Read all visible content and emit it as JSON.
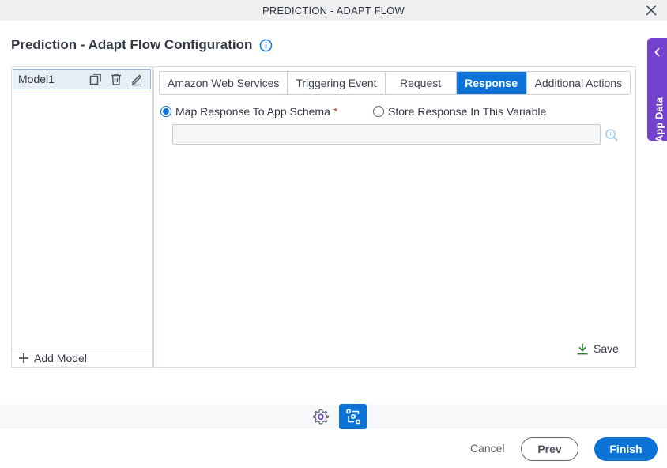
{
  "window": {
    "title": "PREDICTION - ADAPT FLOW",
    "close_icon": "close-icon"
  },
  "header": {
    "title": "Prediction - Adapt Flow Configuration",
    "info_icon": "info-icon"
  },
  "app_data_panel": {
    "label": "App Data",
    "icon": "chevron-left-icon"
  },
  "models": {
    "items": [
      {
        "name": "Model1",
        "actions": [
          "copy-icon",
          "delete-icon",
          "edit-icon"
        ]
      }
    ],
    "add_label": "Add Model"
  },
  "tabs": [
    {
      "label": "Amazon Web Services",
      "active": false
    },
    {
      "label": "Triggering Event",
      "active": false
    },
    {
      "label": "Request",
      "active": false
    },
    {
      "label": "Response",
      "active": true
    },
    {
      "label": "Additional Actions",
      "active": false
    }
  ],
  "response": {
    "option_map_label": "Map Response To App Schema",
    "option_map_required": "*",
    "option_map_selected": true,
    "option_store_label": "Store Response In This Variable",
    "option_store_selected": false,
    "schema_value": "",
    "lookup_icon": "search-chart-icon",
    "save_label": "Save"
  },
  "toolbar": {
    "settings_icon": "gear-icon",
    "flow_icon": "flow-diagram-icon"
  },
  "footer": {
    "cancel_label": "Cancel",
    "prev_label": "Prev",
    "finish_label": "Finish"
  },
  "colors": {
    "primary": "#0c72d6",
    "app_data": "#7342cf",
    "save_icon": "#2e7d32"
  }
}
